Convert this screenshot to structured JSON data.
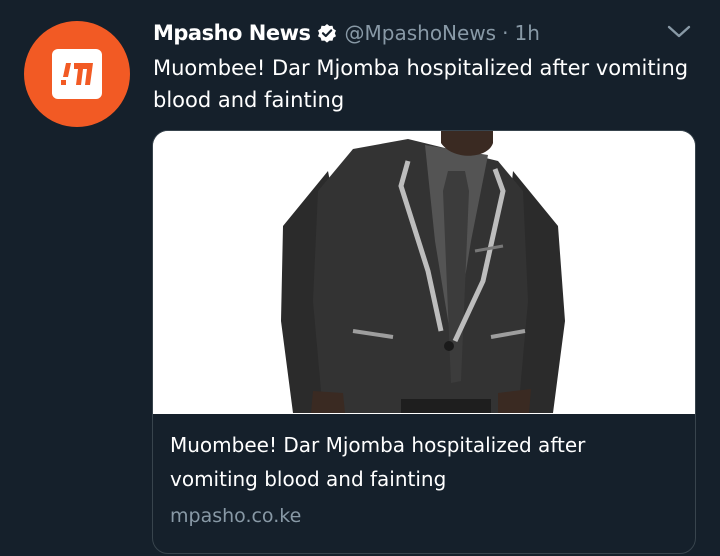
{
  "tweet": {
    "author_name": "Mpasho News",
    "handle": "@MpashoNews",
    "separator": "·",
    "time": "1h",
    "text": "Muombee! Dar Mjomba hospitalized after vomiting blood and fainting",
    "avatar_icon": "mpasho-logo-icon",
    "verified_icon": "verified-badge-icon",
    "menu_icon": "chevron-down-icon"
  },
  "card": {
    "title": "Muombee! Dar Mjomba hospitalized after vomiting blood and fainting",
    "domain": "mpasho.co.ke"
  },
  "colors": {
    "background": "#15202b",
    "secondary_text": "#8899a6",
    "card_border": "#38444d",
    "brand_orange": "#f25a24"
  }
}
